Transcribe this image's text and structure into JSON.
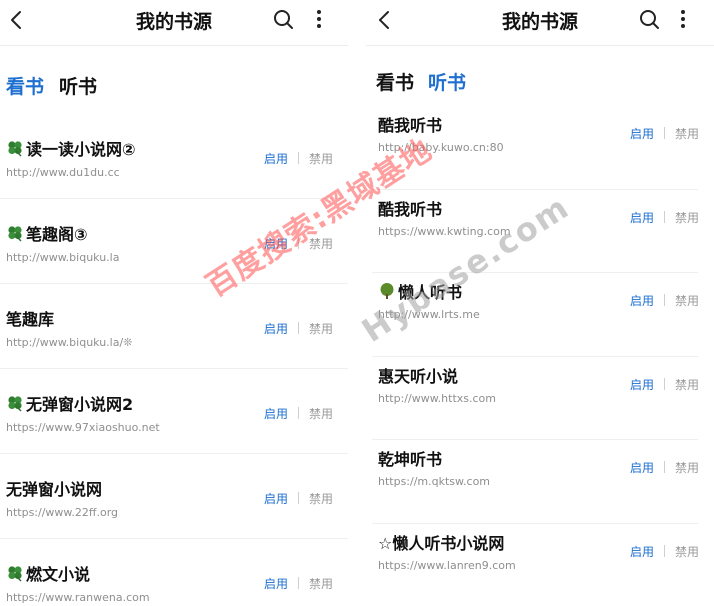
{
  "colors": {
    "accent": "#1e6fd0",
    "url_gray": "#8f8f8f",
    "disable_gray": "#9a9a9a",
    "watermark_red": "#ff5050"
  },
  "left": {
    "title": "我的书源",
    "tabs": [
      {
        "label": "看书",
        "active": true
      },
      {
        "label": "听书",
        "active": false
      }
    ],
    "items": [
      {
        "icon": "clover-icon",
        "name": "读一读小说网②",
        "url": "http://www.du1du.cc",
        "enable": "启用",
        "disable": "禁用"
      },
      {
        "icon": "clover-icon",
        "name": "笔趣阁③",
        "url": "http://www.biquku.la",
        "enable": "启用",
        "disable": "禁用"
      },
      {
        "icon": "",
        "name": "笔趣库",
        "url": "http://www.biquku.la/❊",
        "enable": "启用",
        "disable": "禁用"
      },
      {
        "icon": "clover-icon",
        "name": "无弹窗小说网2",
        "url": "https://www.97xiaoshuo.net",
        "enable": "启用",
        "disable": "禁用"
      },
      {
        "icon": "",
        "name": "无弹窗小说网",
        "url": "https://www.22ff.org",
        "enable": "启用",
        "disable": "禁用"
      },
      {
        "icon": "clover-icon",
        "name": "燃文小说",
        "url": "https://www.ranwena.com",
        "enable": "启用",
        "disable": "禁用"
      }
    ]
  },
  "right": {
    "title": "我的书源",
    "tabs": [
      {
        "label": "看书",
        "active": false
      },
      {
        "label": "听书",
        "active": true
      }
    ],
    "items": [
      {
        "icon": "",
        "name": "酷我听书",
        "url": "http://baby.kuwo.cn:80",
        "enable": "启用",
        "disable": "禁用"
      },
      {
        "icon": "",
        "name": "酷我听书",
        "url": "https://www.kwting.com",
        "enable": "启用",
        "disable": "禁用"
      },
      {
        "icon": "tree-icon",
        "name": "懒人听书",
        "url": "http://www.lrts.me",
        "enable": "启用",
        "disable": "禁用"
      },
      {
        "icon": "",
        "name": "惠天听小说",
        "url": "http://www.httxs.com",
        "enable": "启用",
        "disable": "禁用"
      },
      {
        "icon": "",
        "name": "乾坤听书",
        "url": "https://m.qktsw.com",
        "enable": "启用",
        "disable": "禁用"
      },
      {
        "icon": "",
        "name": "☆懒人听书小说网",
        "url": "https://www.lanren9.com",
        "enable": "启用",
        "disable": "禁用"
      }
    ]
  },
  "watermarks": {
    "cn": "百度搜索:黑域基地",
    "en": "Hybase.com"
  }
}
